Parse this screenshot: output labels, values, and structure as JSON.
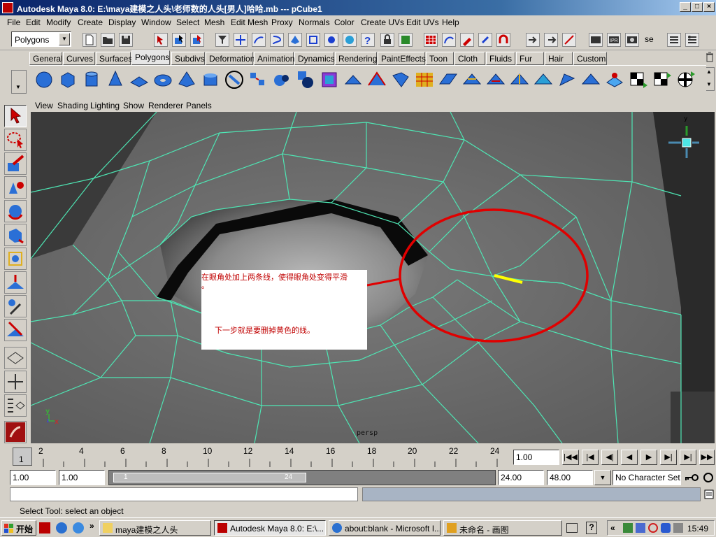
{
  "window": {
    "title": "Autodesk Maya 8.0: E:\\maya建模之人头\\老师数的人头[男人]哈哈.mb  ---  pCube1",
    "min": "_",
    "max": "□",
    "close": "×"
  },
  "menubar": [
    "File",
    "Edit",
    "Modify",
    "Create",
    "Display",
    "Window",
    "Select",
    "Mesh",
    "Edit Mesh",
    "Proxy",
    "Normals",
    "Color",
    "Create UVs",
    "Edit UVs",
    "Help"
  ],
  "statusline": {
    "mode_value": "Polygons",
    "text_se": "se"
  },
  "shelf_tabs": [
    "General",
    "Curves",
    "Surfaces",
    "Polygons",
    "Subdivs",
    "Deformation",
    "Animation",
    "Dynamics",
    "Rendering",
    "PaintEffects",
    "Toon",
    "Cloth",
    "Fluids",
    "Fur",
    "Hair",
    "Custom"
  ],
  "active_shelf_tab": "Polygons",
  "panel_menu": [
    "View",
    "Shading",
    "Lighting",
    "Show",
    "Renderer",
    "Panels"
  ],
  "viewport": {
    "note_line1": "在眼角处加上两条线，使得眼角处变得平滑",
    "note_line2": "。",
    "note_line3": "下一步就是要删掉黄色的线。",
    "camera_label": "persp",
    "axis_y": "y",
    "axis_z": "z",
    "axis_x": "x"
  },
  "timeslider": {
    "ticks": [
      "2",
      "4",
      "6",
      "8",
      "10",
      "12",
      "14",
      "16",
      "18",
      "20",
      "22",
      "24"
    ],
    "current_frame": "1",
    "current_time_value": "1.00"
  },
  "range": {
    "start_time": "1.00",
    "playback_start": "1.00",
    "range_label_start": "1",
    "range_label_end": "24",
    "playback_end": "24.00",
    "end_time": "48.00",
    "character_set": "No Character Set"
  },
  "helpline": "Select Tool: select an object",
  "taskbar": {
    "start": "开始",
    "more": "»",
    "tasks": [
      "maya建模之人头",
      "Autodesk Maya 8.0: E:\\...",
      "about:blank - Microsoft I...",
      "未命名 - 画图"
    ],
    "tray_more": "«",
    "clock": "15:49"
  },
  "colors": {
    "wire": "#4ee6b4",
    "highlight_edge": "#ffff00",
    "annotation": "#e00000",
    "title_start": "#0a246a",
    "title_end": "#a6caf0"
  }
}
